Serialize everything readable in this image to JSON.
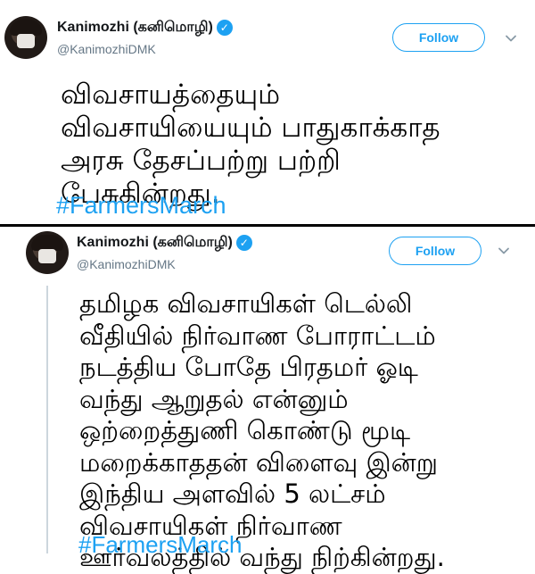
{
  "tweets": [
    {
      "display_name": "Kanimozhi (கனிமொழி)",
      "handle": "@KanimozhiDMK",
      "follow_label": "Follow",
      "text": "விவசாயத்தையும்\nவிவசாயியையும் பாதுகாக்காத\nஅரசு தேசப்பற்று பற்றி\nபேசுகின்றது.",
      "hashtag": "#FarmersMarch"
    },
    {
      "display_name": "Kanimozhi (கனிமொழி)",
      "handle": "@KanimozhiDMK",
      "follow_label": "Follow",
      "text": "தமிழக விவசாயிகள் டெல்லி\nவீதியில் நிர்வாண போராட்டம்\nநடத்திய போதே பிரதமர் ஓடி\nவந்து ஆறுதல் என்னும்\nஒற்றைத்துணி கொண்டு மூடி\nமறைக்காததன் விளைவு இன்று\nஇந்திய அளவில் 5 லட்சம்\nவிவசாயிகள் நிர்வாண\nஊர்வலத்தில் வந்து நிற்கின்றது.",
      "hashtag": "#FarmersMarch"
    }
  ],
  "colors": {
    "accent": "#1da1f2",
    "secondary_text": "#657786",
    "separator": "#000000"
  },
  "icons": {
    "verified": "verified-badge-icon",
    "menu": "chevron-down-icon"
  }
}
